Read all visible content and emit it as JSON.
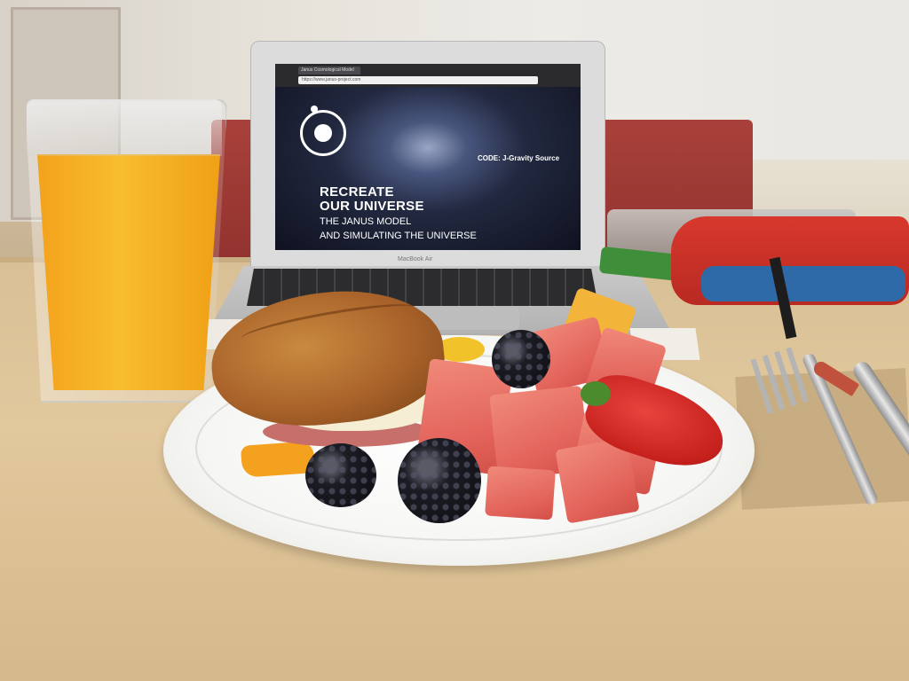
{
  "scene": {
    "description_tag": "breakfast-photo"
  },
  "laptop": {
    "brand_label": "MacBook Air",
    "browser": {
      "tab_label": "Janus Cosmological Model",
      "url": "https://www.janus-project.com"
    },
    "screen": {
      "title_line1": "RECREATE",
      "title_line2": "OUR UNIVERSE",
      "subtitle_line1": "THE JANUS MODEL",
      "subtitle_line2": "AND SIMULATING THE UNIVERSE",
      "code_label": "CODE: J-Gravity Source"
    }
  },
  "colors": {
    "juice": "#f8bd2f",
    "booth": "#a8413a",
    "table": "#e2c89d",
    "watermelon": "#e2625a",
    "strawberry": "#c7211d",
    "blackberry": "#1c1c24",
    "bag_red": "#d8382d"
  }
}
